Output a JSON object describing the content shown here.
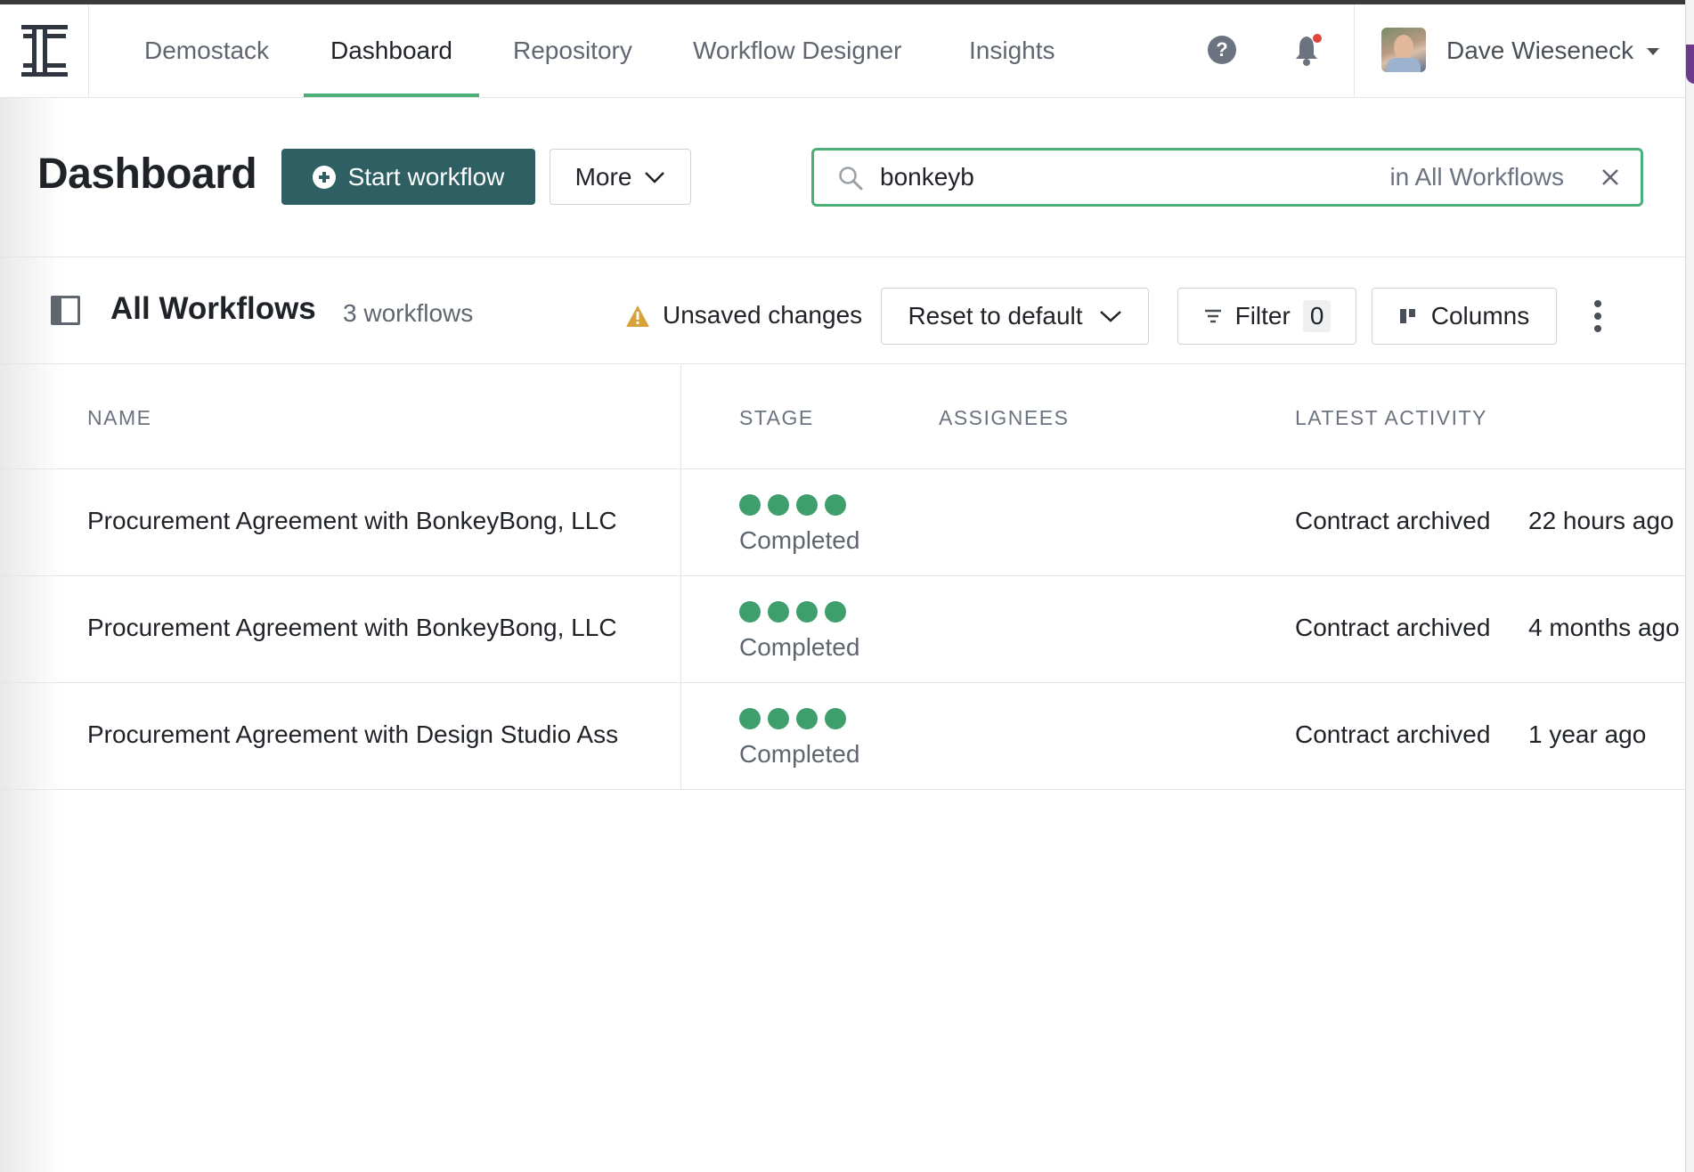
{
  "nav": {
    "tabs": [
      {
        "label": "Demostack"
      },
      {
        "label": "Dashboard",
        "active": true
      },
      {
        "label": "Repository"
      },
      {
        "label": "Workflow Designer"
      },
      {
        "label": "Insights"
      }
    ],
    "user_name": "Dave Wieseneck",
    "icons": [
      "logo-icon",
      "help-icon",
      "bell-icon",
      "avatar",
      "chevron-down-icon"
    ]
  },
  "header": {
    "title": "Dashboard",
    "start_label": "Start workflow",
    "more_label": "More"
  },
  "search": {
    "value": "bonkeyb",
    "scope": "in All Workflows"
  },
  "toolbar": {
    "view_title": "All Workflows",
    "count_label": "3 workflows",
    "unsaved_label": "Unsaved changes",
    "reset_label": "Reset to default",
    "filter_label": "Filter",
    "filter_count": "0",
    "columns_label": "Columns"
  },
  "table": {
    "headers": {
      "name": "NAME",
      "stage": "STAGE",
      "assignees": "ASSIGNEES",
      "latest_activity": "LATEST ACTIVITY"
    },
    "rows": [
      {
        "name": "Procurement Agreement with BonkeyBong, LLC",
        "stage": "Completed",
        "stage_steps_done": 4,
        "assignees": "",
        "activity": "Contract archived",
        "time": "22 hours ago"
      },
      {
        "name": "Procurement Agreement with BonkeyBong, LLC",
        "stage": "Completed",
        "stage_steps_done": 4,
        "assignees": "",
        "activity": "Contract archived",
        "time": "4 months ago"
      },
      {
        "name": "Procurement Agreement with Design Studio Ass",
        "stage": "Completed",
        "stage_steps_done": 4,
        "assignees": "",
        "activity": "Contract archived",
        "time": "1 year ago"
      }
    ]
  },
  "colors": {
    "accent_green": "#4caf78",
    "primary_button": "#2d5f63",
    "stage_dot": "#3d9f6c",
    "warning": "#d8a23a",
    "notification": "#e0443a"
  }
}
